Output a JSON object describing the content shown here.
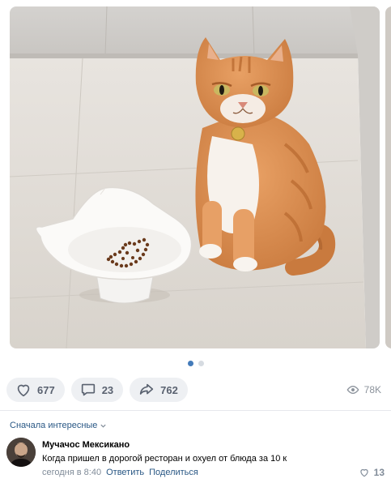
{
  "carousel": {
    "image_alt": "orange-white-cat-sitting-beside-cat-shaped-food-bowl",
    "total_slides": 2,
    "active_slide": 1
  },
  "actions": {
    "likes": "677",
    "comments": "23",
    "shares": "762",
    "views": "78K"
  },
  "comments_section": {
    "sort_label": "Сначала интересные"
  },
  "comment": {
    "author": "Мучачос Мексикано",
    "text": "Когда пришел в дорогой ресторан и охуел от блюда за 10 к",
    "time": "сегодня в 8:40",
    "reply_label": "Ответить",
    "share_label": "Поделиться",
    "likes": "13"
  },
  "colors": {
    "accent": "#447bba",
    "link": "#2a5885",
    "pill_bg": "#eef0f3",
    "muted": "#818c99"
  }
}
